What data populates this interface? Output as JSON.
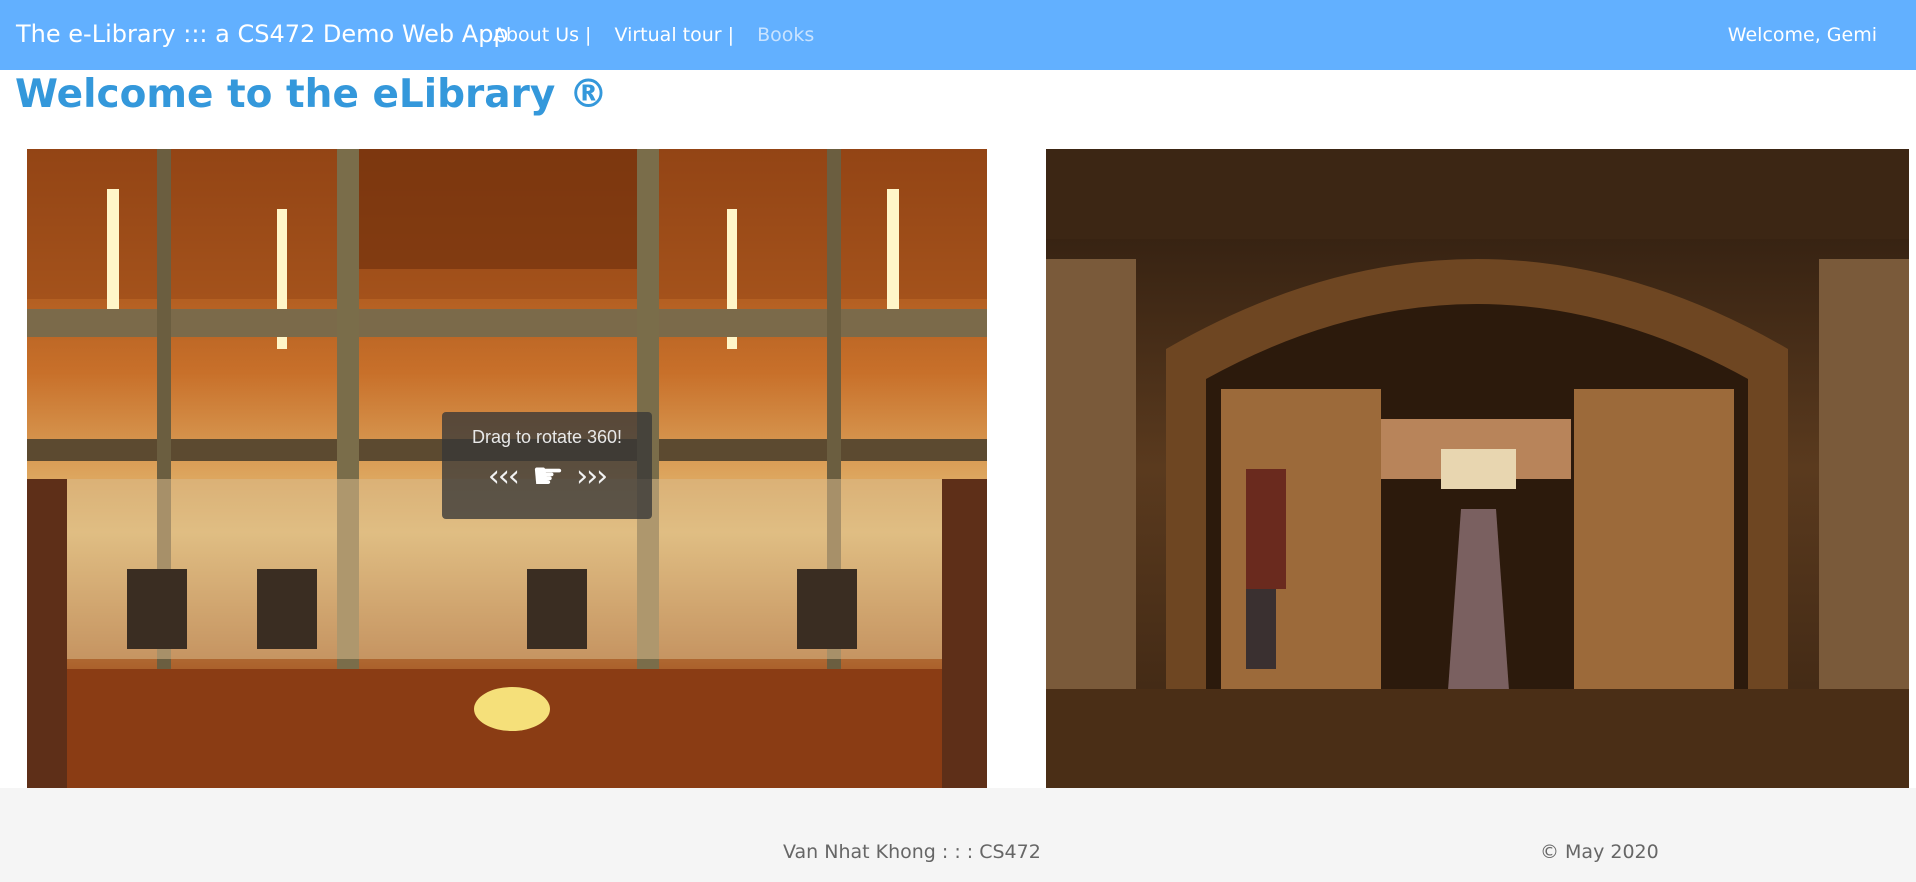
{
  "navbar": {
    "brand": "The e-Library ::: a CS472 Demo Web App",
    "links": [
      {
        "label": "About Us |"
      },
      {
        "label": "Virtual tour |"
      },
      {
        "label": "Books"
      }
    ],
    "welcome": "Welcome, Gemi"
  },
  "main": {
    "title": "Welcome to the eLibrary ®",
    "panorama": {
      "hint_text": "Drag to rotate 360!",
      "left_arrows": "‹‹‹",
      "right_arrows": "›››",
      "hand_icon": "☛"
    }
  },
  "footer": {
    "author": "Van Nhat Khong : : : CS472",
    "copyright": "© May 2020"
  },
  "colors": {
    "navbar": "#62b0ff",
    "title": "#3498db",
    "footer_bg": "#f5f5f5",
    "footer_text": "#666666"
  }
}
